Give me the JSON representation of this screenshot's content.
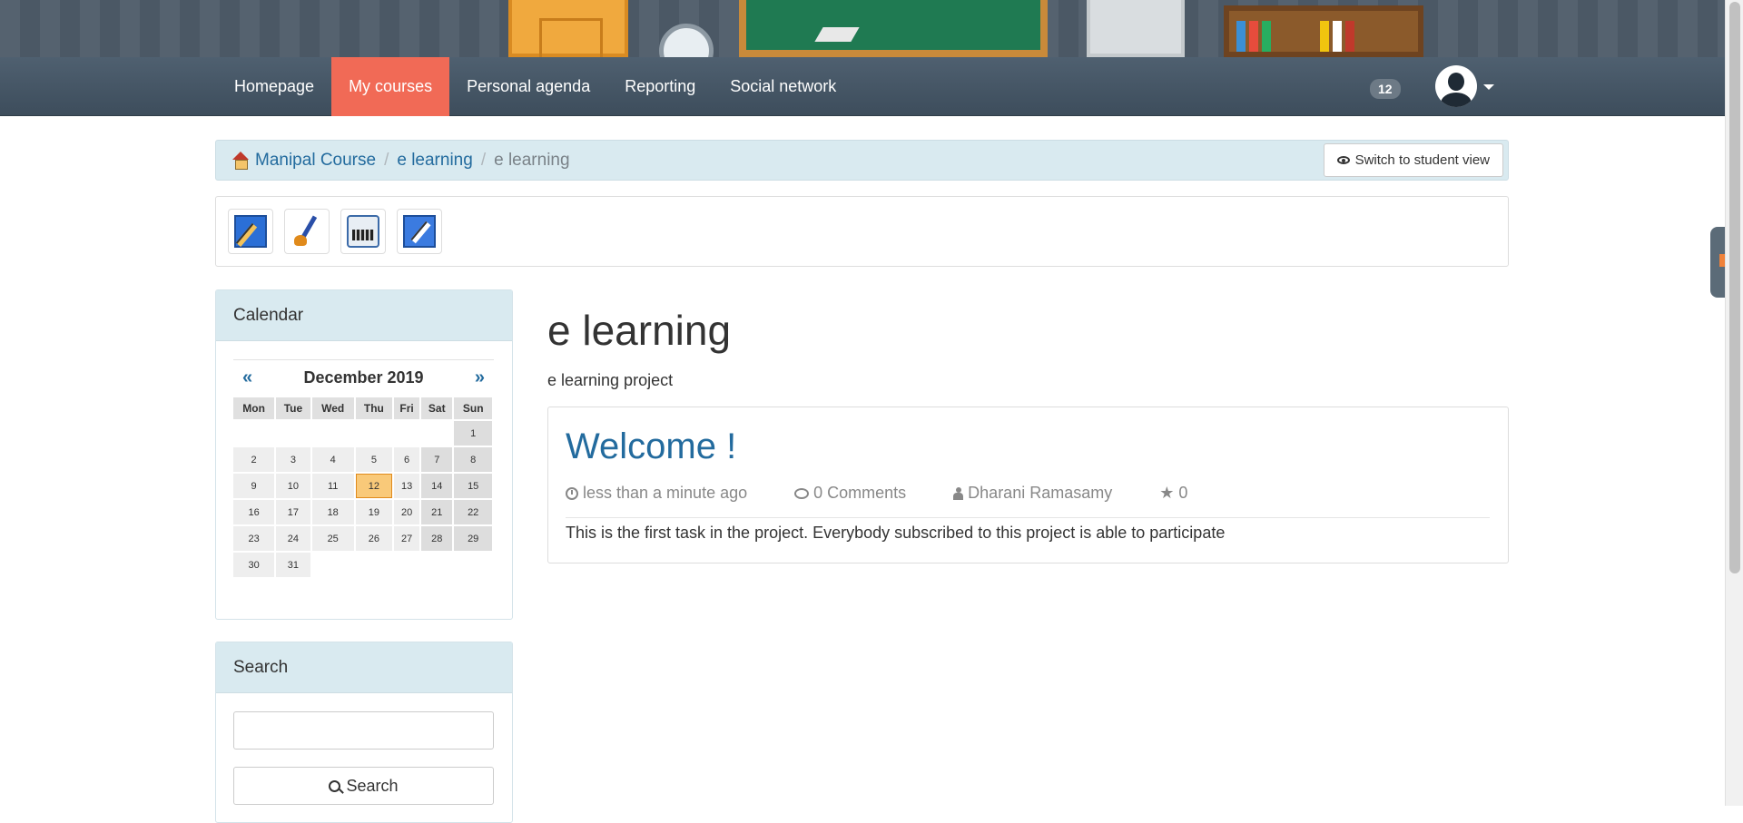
{
  "nav": {
    "items": [
      {
        "label": "Homepage"
      },
      {
        "label": "My courses"
      },
      {
        "label": "Personal agenda"
      },
      {
        "label": "Reporting"
      },
      {
        "label": "Social network"
      }
    ],
    "active_index": 1,
    "notification_count": "12"
  },
  "breadcrumb": {
    "items": [
      "Manipal Course",
      "e learning",
      "e learning"
    ],
    "student_view_label": "Switch to student view"
  },
  "toolbar": {
    "icons": [
      "edit-icon",
      "brush-icon",
      "typewriter-icon",
      "edit-user-icon"
    ]
  },
  "calendar": {
    "title": "Calendar",
    "month_label": "December 2019",
    "prev": "«",
    "next": "»",
    "weekdays": [
      "Mon",
      "Tue",
      "Wed",
      "Thu",
      "Fri",
      "Sat",
      "Sun"
    ],
    "today": 12
  },
  "search": {
    "title": "Search",
    "placeholder": "",
    "button_label": "Search"
  },
  "main": {
    "title": "e learning",
    "subtitle": "e learning project"
  },
  "post": {
    "title": "Welcome !",
    "time": "less than a minute ago",
    "comments": "0 Comments",
    "author": "Dharani Ramasamy",
    "rating": "0",
    "body": "This is the first task in the project. Everybody subscribed to this project is able to participate"
  },
  "colors": {
    "accent_active": "#f16a56",
    "link": "#236b9e",
    "panel_header": "#d9eaf0",
    "today": "#f9c979"
  }
}
